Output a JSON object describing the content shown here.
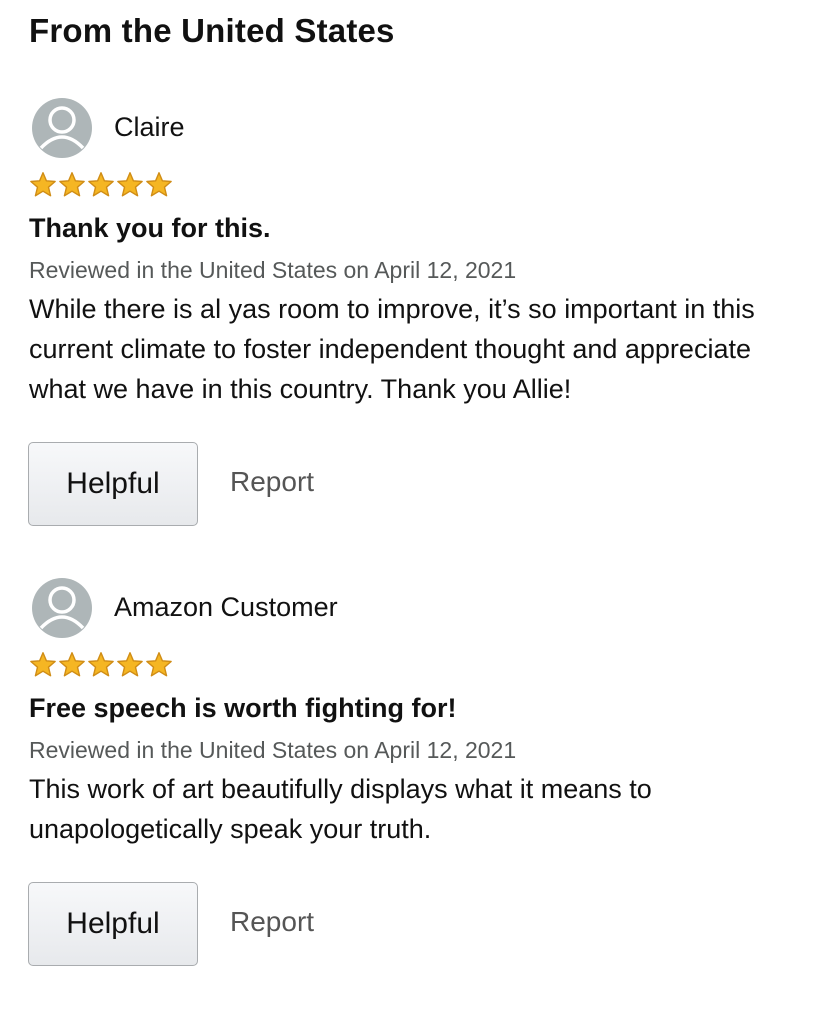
{
  "section_title": "From the United States",
  "reviews": [
    {
      "reviewer": "Claire",
      "rating": 5,
      "title": "Thank you for this.",
      "meta": "Reviewed in the United States on April 12, 2021",
      "body": "While there is al yas room to improve, it’s so important in this current climate to foster independent thought and appreciate what we have in this country. Thank you Allie!",
      "helpful_label": "Helpful",
      "report_label": "Report"
    },
    {
      "reviewer": "Amazon Customer",
      "rating": 5,
      "title": "Free speech is worth fighting for!",
      "meta": "Reviewed in the United States on April 12, 2021",
      "body": "This work of art beautifully displays what it means to unapologetically speak your truth.",
      "helpful_label": "Helpful",
      "report_label": "Report"
    }
  ],
  "icons": {
    "avatar": "user-avatar-icon",
    "star": "star-icon"
  },
  "colors": {
    "star_fill": "#f5b623",
    "star_stroke": "#d08d16",
    "avatar_bg": "#aeb6b8",
    "meta_text": "#565959"
  }
}
